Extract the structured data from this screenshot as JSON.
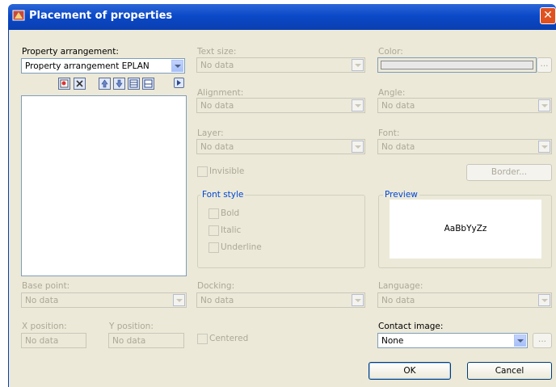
{
  "window": {
    "title": "Placement of properties",
    "close_glyph": "✕"
  },
  "property_arrangement": {
    "label": "Property arrangement:",
    "value": "Property arrangement EPLAN"
  },
  "toolbar": {
    "icons": [
      "new-icon",
      "delete-icon",
      "move-up-icon",
      "move-down-icon",
      "insert-before-icon",
      "insert-after-icon",
      "more-icon"
    ]
  },
  "text_size": {
    "label": "Text size:",
    "value": "No data"
  },
  "color": {
    "label": "Color:",
    "button": "..."
  },
  "alignment": {
    "label": "Alignment:",
    "value": "No data"
  },
  "angle": {
    "label": "Angle:",
    "value": "No data"
  },
  "layer": {
    "label": "Layer:",
    "value": "No data"
  },
  "font": {
    "label": "Font:",
    "value": "No data"
  },
  "invisible": {
    "label": "Invisible"
  },
  "border_button": {
    "label": "Border..."
  },
  "font_style": {
    "title": "Font style",
    "bold": "Bold",
    "italic": "Italic",
    "underline": "Underline"
  },
  "preview": {
    "title": "Preview",
    "sample": "AaBbYyZz"
  },
  "base_point": {
    "label": "Base point:",
    "value": "No data"
  },
  "docking": {
    "label": "Docking:",
    "value": "No data"
  },
  "language": {
    "label": "Language:",
    "value": "No data"
  },
  "x_position": {
    "label": "X position:",
    "value": "No data"
  },
  "y_position": {
    "label": "Y position:",
    "value": "No data"
  },
  "centered": {
    "label": "Centered"
  },
  "contact_image": {
    "label": "Contact image:",
    "value": "None",
    "button": "..."
  },
  "ok_button": {
    "label": "OK"
  },
  "cancel_button": {
    "label": "Cancel"
  },
  "colors": {
    "titlebar": "#0a46c8",
    "dialog_bg": "#ece9d8",
    "group_title": "#0046d5"
  }
}
